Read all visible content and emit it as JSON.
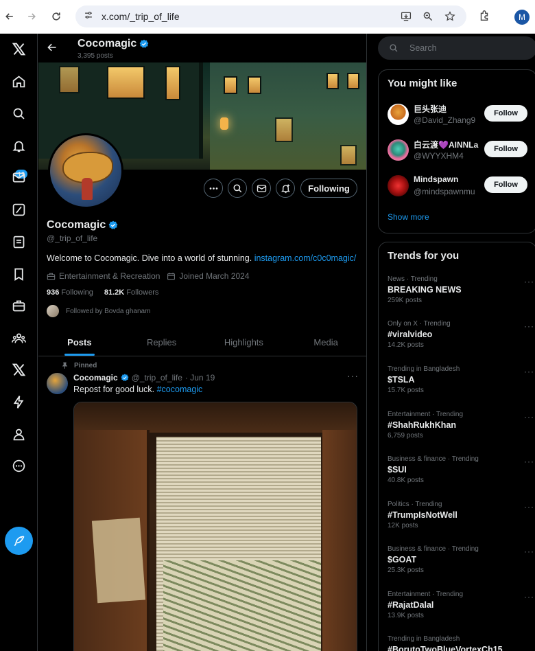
{
  "browser": {
    "url": "x.com/_trip_of_life",
    "profile_initial": "M"
  },
  "sidebar": {
    "notifications_badge": "13"
  },
  "header": {
    "name": "Cocomagic",
    "posts_count": "3,395 posts"
  },
  "profile": {
    "name": "Cocomagic",
    "handle": "@_trip_of_life",
    "bio_text": "Welcome to Cocomagic. Dive into a world of stunning. ",
    "bio_link": "instagram.com/c0c0magic/",
    "category": "Entertainment & Recreation",
    "joined": "Joined March 2024",
    "following_count": "936",
    "following_label": "Following",
    "followers_count": "81.2K",
    "followers_label": "Followers",
    "followed_by": "Followed by Bovda ghanam",
    "following_button": "Following"
  },
  "tabs": [
    "Posts",
    "Replies",
    "Highlights",
    "Media"
  ],
  "post": {
    "pinned_label": "Pinned",
    "author": "Cocomagic",
    "handle": "@_trip_of_life",
    "date": "· Jun 19",
    "text": "Repost for good luck. ",
    "hashtag": "#cocomagic"
  },
  "search": {
    "placeholder": "Search"
  },
  "you_might_like": {
    "title": "You might like",
    "items": [
      {
        "name": "巨头张迪",
        "handle": "@David_Zhang9",
        "button": "Follow"
      },
      {
        "name": "白云渡💜AINNLa",
        "handle": "@WYYXHM4",
        "button": "Follow"
      },
      {
        "name": "Mindspawn",
        "handle": "@mindspawnmu",
        "button": "Follow"
      }
    ],
    "show_more": "Show more"
  },
  "trends": {
    "title": "Trends for you",
    "items": [
      {
        "context": "News · Trending",
        "topic": "BREAKING NEWS",
        "count": "259K posts"
      },
      {
        "context": "Only on X · Trending",
        "topic": "#viralvideo",
        "count": "14.2K posts"
      },
      {
        "context": "Trending in Bangladesh",
        "topic": "$TSLA",
        "count": "15.7K posts"
      },
      {
        "context": "Entertainment · Trending",
        "topic": "#ShahRukhKhan",
        "count": "6,759 posts"
      },
      {
        "context": "Business & finance · Trending",
        "topic": "$SUI",
        "count": "40.8K posts"
      },
      {
        "context": "Politics · Trending",
        "topic": "#TrumpIsNotWell",
        "count": "12K posts"
      },
      {
        "context": "Business & finance · Trending",
        "topic": "$GOAT",
        "count": "25.3K posts"
      },
      {
        "context": "Entertainment · Trending",
        "topic": "#RajatDalal",
        "count": "13.9K posts"
      },
      {
        "context": "Trending in Bangladesh",
        "topic": "#BorutoTwoBlueVortexCh15",
        "count": ""
      }
    ]
  }
}
